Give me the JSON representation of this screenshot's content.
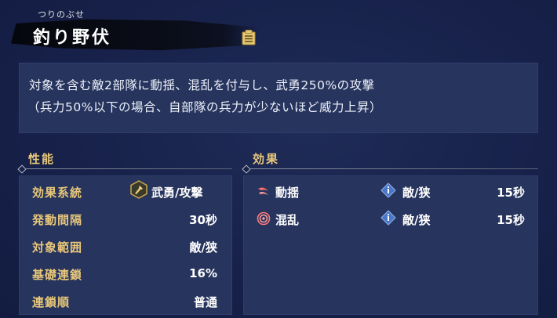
{
  "header": {
    "ruby": "つりのぶせ",
    "name": "釣り野伏"
  },
  "description": {
    "line1": "対象を含む敵2部隊に動揺、混乱を付与し、武勇250%の攻撃",
    "line2": "（兵力50%以下の場合、自部隊の兵力が少ないほど威力上昇）"
  },
  "performance": {
    "title": "性能",
    "rows": [
      {
        "label": "効果系統",
        "value": "武勇/攻撃"
      },
      {
        "label": "発動間隔",
        "value": "30秒"
      },
      {
        "label": "対象範囲",
        "value": "敵/狭"
      },
      {
        "label": "基礎連鎖",
        "value": "16%"
      },
      {
        "label": "連鎖順",
        "value": "普通"
      }
    ]
  },
  "effects": {
    "title": "効果",
    "rows": [
      {
        "name": "動揺",
        "target": "敵/狭",
        "duration": "15秒",
        "icon": "shaken-icon"
      },
      {
        "name": "混乱",
        "target": "敵/狭",
        "duration": "15秒",
        "icon": "confusion-icon"
      }
    ]
  },
  "colors": {
    "background": "#16224a",
    "box": "#27345d",
    "label_gold": "#e8c77a"
  }
}
